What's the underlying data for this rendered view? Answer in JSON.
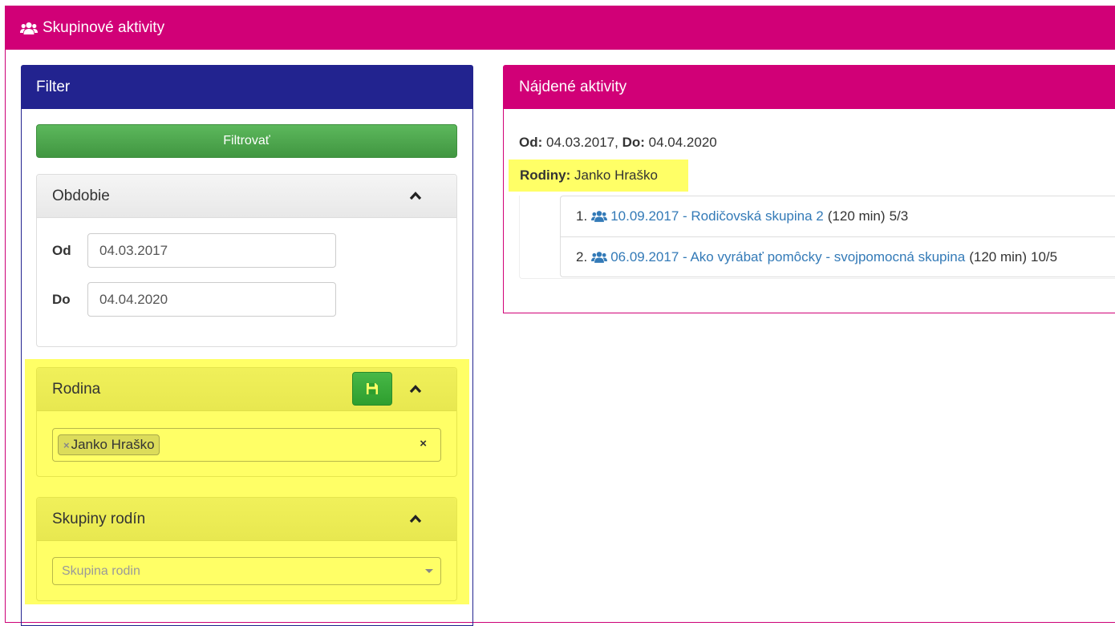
{
  "header": {
    "title": "Skupinové aktivity",
    "icon": "users-icon",
    "color": "#d10077"
  },
  "filter": {
    "title": "Filter",
    "color": "#22238f",
    "filter_button": "Filtrovať",
    "period": {
      "title": "Obdobie",
      "from_label": "Od",
      "from_value": "04.03.2017",
      "to_label": "Do",
      "to_value": "04.04.2020"
    },
    "family": {
      "title": "Rodina",
      "selected": "Janko Hraško",
      "tag_remove": "×",
      "clear": "×"
    },
    "family_groups": {
      "title": "Skupiny rodín",
      "placeholder": "Skupina rodin"
    },
    "highlight_color": "#ffff66"
  },
  "results": {
    "title": "Nájdené aktivity",
    "from_label": "Od:",
    "from_value": "04.03.2017",
    "separator": ",",
    "to_label": "Do:",
    "to_value": "04.04.2020",
    "families_label": "Rodiny:",
    "families_value": "Janko Hraško",
    "items": [
      {
        "num": "1.",
        "link": "10.09.2017 - Rodičovská skupina 2",
        "duration": "(120 min)",
        "count": "5/3"
      },
      {
        "num": "2.",
        "link": "06.09.2017 - Ako vyrábať pomôcky - svojpomocná skupina",
        "duration": "(120 min)",
        "count": "10/5"
      }
    ]
  }
}
